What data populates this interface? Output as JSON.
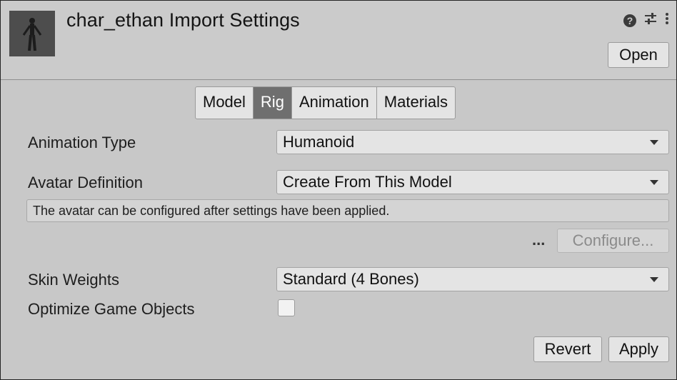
{
  "header": {
    "title": "char_ethan Import Settings",
    "open_label": "Open",
    "icons": [
      "help-icon",
      "preset-sliders-icon",
      "kebab-menu-icon"
    ]
  },
  "tabs": [
    {
      "label": "Model",
      "active": false
    },
    {
      "label": "Rig",
      "active": true
    },
    {
      "label": "Animation",
      "active": false
    },
    {
      "label": "Materials",
      "active": false
    }
  ],
  "fields": {
    "animation_type": {
      "label": "Animation Type",
      "value": "Humanoid"
    },
    "avatar_definition": {
      "label": "Avatar Definition",
      "value": "Create From This Model"
    },
    "skin_weights": {
      "label": "Skin Weights",
      "value": "Standard (4 Bones)"
    },
    "optimize_game_objects": {
      "label": "Optimize Game Objects",
      "checked": false
    }
  },
  "info": {
    "message": "The avatar can be configured after settings have been applied.",
    "dots": "...",
    "configure_label": "Configure..."
  },
  "footer": {
    "revert_label": "Revert",
    "apply_label": "Apply"
  }
}
